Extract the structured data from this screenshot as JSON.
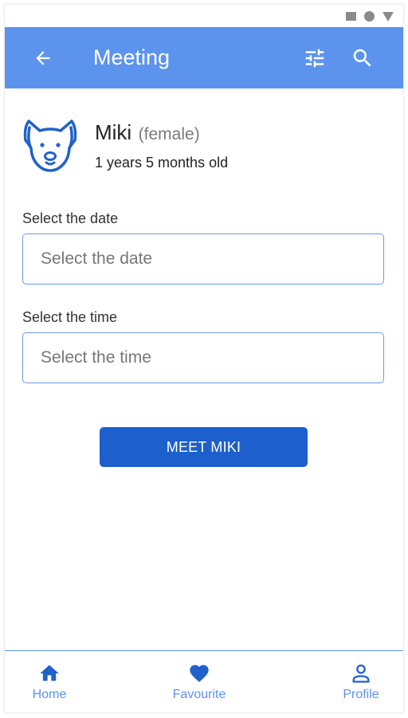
{
  "app_bar": {
    "title": "Meeting",
    "back_icon": "arrow-left-icon",
    "filter_icon": "tune-icon",
    "search_icon": "search-icon",
    "background_color": "#5c93ec"
  },
  "pet": {
    "name": "Miki",
    "gender": "(female)",
    "age": "1 years 5 months old",
    "avatar_icon": "dog-face-icon"
  },
  "form": {
    "date_label": "Select the date",
    "date_placeholder": "Select the date",
    "time_label": "Select the time",
    "time_placeholder": "Select the time",
    "submit_label": "MEET MIKI",
    "accent_color": "#1d5fcc"
  },
  "bottom_nav": {
    "items": [
      {
        "label": "Home",
        "icon": "home-icon"
      },
      {
        "label": "Favourite",
        "icon": "heart-icon"
      },
      {
        "label": "Profile",
        "icon": "person-icon"
      }
    ]
  }
}
